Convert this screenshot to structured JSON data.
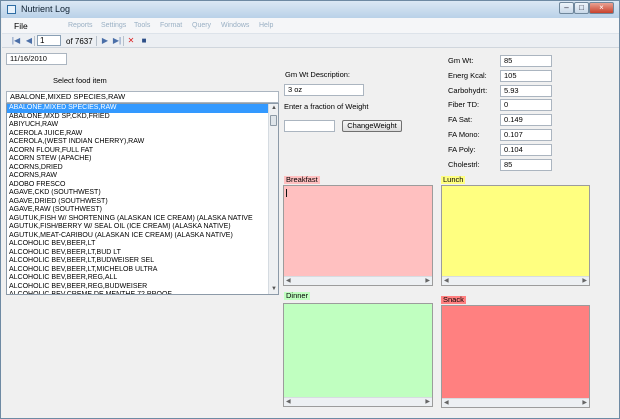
{
  "window": {
    "title": "Nutrient Log"
  },
  "menubar": {
    "file": "File",
    "ghost_items": [
      "Reports",
      "Settings",
      "Tools",
      "Format",
      "Query",
      "Windows",
      "Help"
    ]
  },
  "toolbar": {
    "position": "1",
    "total": "of 7637",
    "first_icon": "first-record-icon",
    "prev_icon": "previous-record-icon",
    "next_icon": "next-record-icon",
    "last_icon": "last-record-icon",
    "delete_icon": "delete-icon",
    "save_icon": "save-icon"
  },
  "date": {
    "value": "11/16/2010"
  },
  "food": {
    "label": "Select food item",
    "selected": "ABALONE,MIXED SPECIES,RAW",
    "items": [
      "ABALONE,MIXED SPECIES,RAW",
      "ABALONE,MXD SP,CKD,FRIED",
      "ABIYUCH,RAW",
      "ACEROLA JUICE,RAW",
      "ACEROLA,(WEST INDIAN CHERRY),RAW",
      "ACORN FLOUR,FULL FAT",
      "ACORN STEW (APACHE)",
      "ACORNS,DRIED",
      "ACORNS,RAW",
      "ADOBO FRESCO",
      "AGAVE,CKD (SOUTHWEST)",
      "AGAVE,DRIED (SOUTHWEST)",
      "AGAVE,RAW (SOUTHWEST)",
      "AGUTUK,FISH W/ SHORTENING (ALASKAN ICE CREAM) (ALASKA NATIVE",
      "AGUTUK,FISH/BERRY W/ SEAL OIL (ICE CREAM) (ALASKA NATIVE)",
      "AGUTUK,MEAT-CARIBOU (ALASKAN ICE CREAM) (ALASKA NATIVE)",
      "ALCOHOLIC BEV,BEER,LT",
      "ALCOHOLIC BEV,BEER,LT,BUD LT",
      "ALCOHOLIC BEV,BEER,LT,BUDWEISER SEL",
      "ALCOHOLIC BEV,BEER,LT,MICHELOB ULTRA",
      "ALCOHOLIC BEV,BEER,REG,ALL",
      "ALCOHOLIC BEV,BEER,REG,BUDWEISER",
      "ALCOHOLIC BEV,CREME DE MENTHE,72 PROOF"
    ]
  },
  "weight": {
    "desc_label": "Gm Wt Description:",
    "desc_value": "3 oz",
    "fraction_label": "Enter a fraction of Weight",
    "fraction_value": "",
    "change_button": "ChangeWeight"
  },
  "nutrients": [
    {
      "label": "Gm Wt:",
      "value": "85"
    },
    {
      "label": "Energ Kcal:",
      "value": "105"
    },
    {
      "label": "Carbohydrt:",
      "value": "5.93"
    },
    {
      "label": "Fiber TD:",
      "value": "0"
    },
    {
      "label": "FA Sat:",
      "value": "0.149"
    },
    {
      "label": "FA Mono:",
      "value": "0.107"
    },
    {
      "label": "FA Poly:",
      "value": "0.104"
    },
    {
      "label": "Cholestrl:",
      "value": "85"
    }
  ],
  "meals": {
    "breakfast": {
      "label": "Breakfast",
      "color": "#ffc0c0"
    },
    "lunch": {
      "label": "Lunch",
      "color": "#ffff80"
    },
    "dinner": {
      "label": "Dinner",
      "color": "#c0ffc0"
    },
    "snack": {
      "label": "Snack",
      "color": "#ff8080"
    }
  },
  "colors": {
    "selection": "#3399ff",
    "titlebar": "#b9d1e8"
  }
}
